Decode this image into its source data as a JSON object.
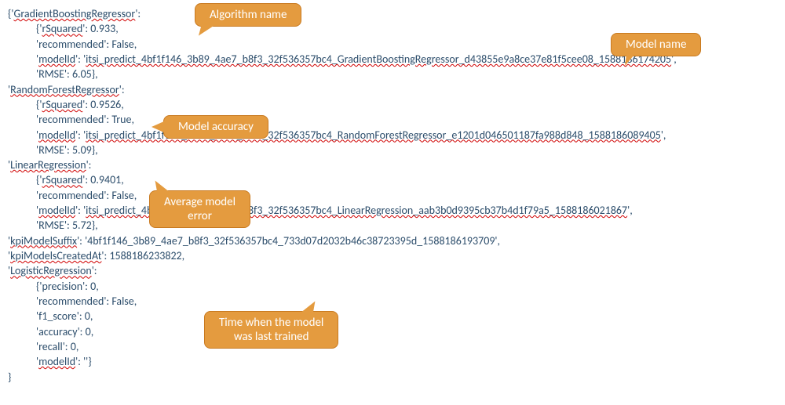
{
  "code": {
    "open": "{'",
    "gbr": {
      "name": "GradientBoostingRegressor",
      "rSquaredKey": "rSquared",
      "rSquaredVal": "0.933",
      "recKey": "recommended",
      "recVal": "False",
      "modelIdKey": "modelId",
      "modelIdVal": "itsi_predict_4bf1f146_3b89_4ae7_b8f3_32f536357bc4_GradientBoostingRegressor_d43855e9a8ce37e81f5cee08_1588186174205",
      "rmseKey": "RMSE",
      "rmseVal": "6.05"
    },
    "rfr": {
      "name": "RandomForestRegressor",
      "rSquaredKey": "rSquared",
      "rSquaredVal": "0.9526",
      "recKey": "recommended",
      "recVal": "True",
      "modelIdKey": "modelId",
      "modelIdVal": "itsi_predict_4bf1f146_3b89_4ae7_b8f3_32f536357bc4_RandomForestRegressor_e1201d046501187fa988d848_1588186089405",
      "rmseKey": "RMSE",
      "rmseVal": "5.09"
    },
    "lr": {
      "name": "LinearRegression",
      "rSquaredKey": "rSquared",
      "rSquaredVal": "0.9401",
      "recKey": "recommended",
      "recVal": "False",
      "modelIdKey": "modelId",
      "modelIdVal": "itsi_predict_4bf1f146_3b89_4ae7_b8f3_32f536357bc4_LinearRegression_aab3b0d9395cb37b4d1f79a5_1588186021867",
      "rmseKey": "RMSE",
      "rmseVal": "5.72"
    },
    "kpiSuffixKey": "kpiModelSuffix",
    "kpiSuffixVal": "4bf1f146_3b89_4ae7_b8f3_32f536357bc4_733d07d2032b46c38723395d_1588186193709",
    "kpiCreatedKey": "kpiModelsCreatedAt",
    "kpiCreatedVal": "1588186233822",
    "log": {
      "name": "LogisticRegression",
      "precisionKey": "precision",
      "precisionVal": "0",
      "recKey": "recommended",
      "recVal": "False",
      "f1Key": "f1_score",
      "f1Val": "0",
      "accKey": "accuracy",
      "accVal": "0",
      "recallKey": "recall",
      "recallVal": "0",
      "modelIdKey": "modelId",
      "modelIdVal": ""
    },
    "close": "}"
  },
  "callouts": {
    "alg": "Algorithm name",
    "modelname": "Model name",
    "accuracy": "Model accuracy",
    "error1": "Average model",
    "error2": "error",
    "time1": "Time when the model",
    "time2": "was last trained"
  }
}
